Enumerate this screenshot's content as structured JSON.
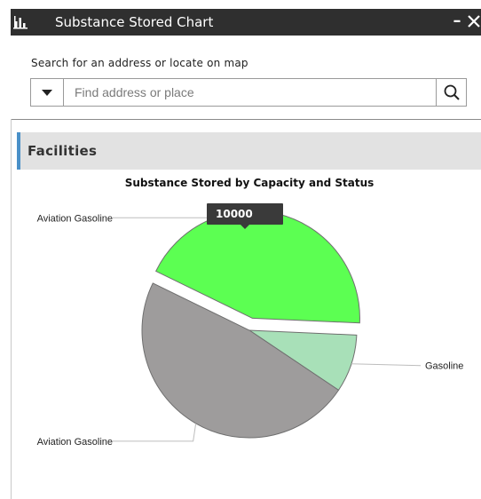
{
  "window": {
    "title": "Substance Stored Chart",
    "minimize_label": "–",
    "close_label": "✕",
    "icon": "bar-chart-icon"
  },
  "search": {
    "label": "Search for an address or locate on map",
    "placeholder": "Find address or place",
    "value": "",
    "dropdown_icon": "caret-down-icon",
    "search_icon": "magnifier-icon"
  },
  "section": {
    "title": "Facilities"
  },
  "colors": {
    "title_bar": "#2f2f2f",
    "section_accent": "#4a90c8",
    "slice_aviation_top": "#5cff52",
    "slice_gasoline": "#a8e0b8",
    "slice_aviation_bottom": "#9e9c9c"
  },
  "chart_data": {
    "type": "pie",
    "title": "Substance Stored by Capacity and Status",
    "categories": [
      "Aviation Gasoline",
      "Gasoline",
      "Aviation Gasoline"
    ],
    "values": [
      10000,
      2000,
      11000
    ],
    "colors": [
      "#5cff52",
      "#a8e0b8",
      "#9e9c9c"
    ],
    "exploded_index": 0,
    "tooltip": {
      "index": 0,
      "text": "10000"
    },
    "legend": "none"
  }
}
